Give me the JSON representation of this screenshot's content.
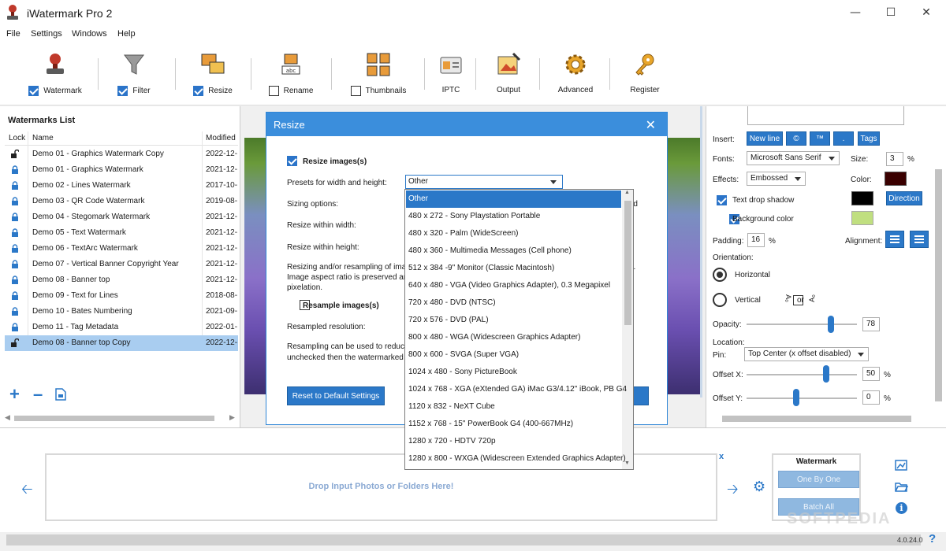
{
  "app": {
    "title": "iWatermark Pro 2",
    "version": "4.0.24.0"
  },
  "menu": [
    "File",
    "Settings",
    "Windows",
    "Help"
  ],
  "toolbar": {
    "watermark": {
      "label": "Watermark",
      "checked": true
    },
    "filter": {
      "label": "Filter",
      "checked": true
    },
    "resize": {
      "label": "Resize",
      "checked": true
    },
    "rename": {
      "label": "Rename",
      "checked": false
    },
    "thumbnails": {
      "label": "Thumbnails",
      "checked": false
    },
    "iptc": {
      "label": "IPTC"
    },
    "output": {
      "label": "Output"
    },
    "advanced": {
      "label": "Advanced"
    },
    "register": {
      "label": "Register"
    }
  },
  "watermarks": {
    "title": "Watermarks List",
    "columns": [
      "Lock",
      "Name",
      "Modified"
    ],
    "rows": [
      {
        "name": "Demo 01 - Graphics Watermark Copy",
        "modified": "2022-12-",
        "locked": false
      },
      {
        "name": "Demo 01 - Graphics Watermark",
        "modified": "2021-12-",
        "locked": true
      },
      {
        "name": "Demo 02 - Lines Watermark",
        "modified": "2017-10-",
        "locked": true
      },
      {
        "name": "Demo 03 - QR Code Watermark",
        "modified": "2019-08-",
        "locked": true
      },
      {
        "name": "Demo 04 - Stegomark Watermark",
        "modified": "2021-12-",
        "locked": true
      },
      {
        "name": "Demo 05 - Text Watermark",
        "modified": "2021-12-",
        "locked": true
      },
      {
        "name": "Demo 06 - TextArc Watermark",
        "modified": "2021-12-",
        "locked": true
      },
      {
        "name": "Demo 07 - Vertical Banner Copyright Year",
        "modified": "2021-12-",
        "locked": true
      },
      {
        "name": "Demo 08 - Banner top",
        "modified": "2021-12-",
        "locked": true
      },
      {
        "name": "Demo 09 - Text for Lines",
        "modified": "2018-08-",
        "locked": true
      },
      {
        "name": "Demo 10 - Bates Numbering",
        "modified": "2021-09-",
        "locked": true
      },
      {
        "name": "Demo 11 - Tag Metadata",
        "modified": "2022-01-",
        "locked": true
      },
      {
        "name": "Demo 08 - Banner top Copy",
        "modified": "2022-12-",
        "locked": false,
        "selected": true
      }
    ]
  },
  "dialog": {
    "title": "Resize",
    "resize_images_label": "Resize images(s)",
    "presets_label": "Presets for width and height:",
    "preset_value": "Other",
    "sizing_label": "Sizing options:",
    "within_width_label": "Resize within width:",
    "within_height_label": "Resize within height:",
    "info_1a": "Resizing and/or resampling of ima",
    "info_1b": "Image aspect ratio is preserved an",
    "info_1c": "pixelation.",
    "info_1_tail": "e.",
    "sizing_tail": "cted",
    "resample_label": "Resample images(s)",
    "resampled_label": "Resampled resolution:",
    "info_2a": "Resampling can be used to reduce",
    "info_2b": "unchecked then the watermarked",
    "reset_label": "Reset to Default Settings"
  },
  "presets": [
    "Other",
    "480 x 272 - Sony Playstation Portable",
    "480 x 320 - Palm (WideScreen)",
    "480 x 360 - Multimedia Messages (Cell phone)",
    "512 x 384 -9\" Monitor (Classic Macintosh)",
    "640 x 480 - VGA (Video Graphics Adapter), 0.3 Megapixel",
    "720 x 480 - DVD (NTSC)",
    "720 x 576 - DVD (PAL)",
    "800 x 480 - WGA (Widescreen Graphics Adapter)",
    "800 x 600 - SVGA (Super VGA)",
    "1024 x 480 - Sony PictureBook",
    "1024 x 768 - XGA (eXtended GA) iMac G3/4.12\" iBook, PB G4",
    "1120 x 832 - NeXT Cube",
    "1152 x 768 - 15\" PowerBook G4 (400-667MHz)",
    "1280 x 720 - HDTV 720p",
    "1280 x 800 - WXGA (Widescreen Extended Graphics Adapter)"
  ],
  "text_settings": {
    "insert_label": "Insert:",
    "insert_buttons": [
      "New line",
      "©",
      "™",
      ".",
      "Tags"
    ],
    "fonts_label": "Fonts:",
    "font_value": "Microsoft Sans Serif",
    "size_label": "Size:",
    "size_value": "3",
    "size_unit": "%",
    "effects_label": "Effects:",
    "effects_value": "Embossed",
    "color_label": "Color:",
    "color": "#3a0000",
    "drop_shadow_label": "Text drop shadow",
    "drop_shadow_color": "#000000",
    "direction_label": "Direction",
    "background_label": "Background color",
    "background_color": "#c0df80",
    "padding_label": "Padding:",
    "padding_value": "16",
    "padding_unit": "%",
    "alignment_label": "Alignment:",
    "orientation_label": "Orientation:",
    "horizontal_label": "Horizontal",
    "vertical_label": "Vertical",
    "or_label": "or",
    "opacity_label": "Opacity:",
    "opacity_value": "78",
    "location_label": "Location:",
    "pin_label": "Pin:",
    "pin_value": "Top Center (x offset disabled)",
    "offset_x_label": "Offset X:",
    "offset_x_value": "50",
    "offset_y_label": "Offset Y:",
    "offset_y_value": "0",
    "pct": "%"
  },
  "bottom": {
    "drop_text": "Drop Input Photos or Folders Here!",
    "close_x": "x",
    "watermark_title": "Watermark",
    "one_by_one": "One By One",
    "batch_all": "Batch All"
  },
  "colors": {
    "accent": "#2b78c8",
    "title_bar": "#3b8edc",
    "selected_row": "#a9cdf0"
  }
}
